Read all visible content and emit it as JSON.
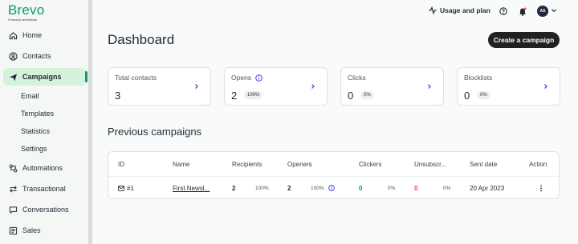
{
  "brand": {
    "name": "Brevo",
    "tagline": "Formerly sendinblue"
  },
  "sidebar": {
    "items": [
      {
        "label": "Home",
        "icon": "home-icon"
      },
      {
        "label": "Contacts",
        "icon": "contacts-icon"
      },
      {
        "label": "Campaigns",
        "icon": "send-icon",
        "active": true
      },
      {
        "label": "Automations",
        "icon": "automation-icon"
      },
      {
        "label": "Transactional",
        "icon": "transactional-icon"
      },
      {
        "label": "Conversations",
        "icon": "chat-icon"
      },
      {
        "label": "Sales",
        "icon": "sales-icon"
      }
    ],
    "subitems": [
      "Email",
      "Templates",
      "Statistics",
      "Settings"
    ]
  },
  "topbar": {
    "usage_label": "Usage and plan",
    "avatar_initials": "AS"
  },
  "header": {
    "title": "Dashboard",
    "create_label": "Create a campaign"
  },
  "stats": [
    {
      "label": "Total contacts",
      "value": "3",
      "badge": ""
    },
    {
      "label": "Opens",
      "value": "2",
      "badge": "100%",
      "info": true
    },
    {
      "label": "Clicks",
      "value": "0",
      "badge": "0%"
    },
    {
      "label": "Blocklists",
      "value": "0",
      "badge": "0%"
    }
  ],
  "section_title": "Previous campaigns",
  "table": {
    "columns": [
      "ID",
      "Name",
      "Recipients",
      "Openers",
      "Clickers",
      "Unsubscr...",
      "Sent date",
      "Action"
    ],
    "rows": [
      {
        "id": "#1",
        "name": "First Newsl...",
        "recipients": "2",
        "recipients_pct": "100%",
        "openers": "2",
        "openers_pct": "100%",
        "clickers": "0",
        "clickers_pct": "0%",
        "unsub": "0",
        "unsub_pct": "0%",
        "sent_date": "20 Apr 2023"
      }
    ]
  },
  "colors": {
    "brand": "#0b996e",
    "active_bg": "#d4f3da",
    "link": "#3b3fd9",
    "clickers": "#0b996e",
    "unsub": "#e5532d"
  }
}
